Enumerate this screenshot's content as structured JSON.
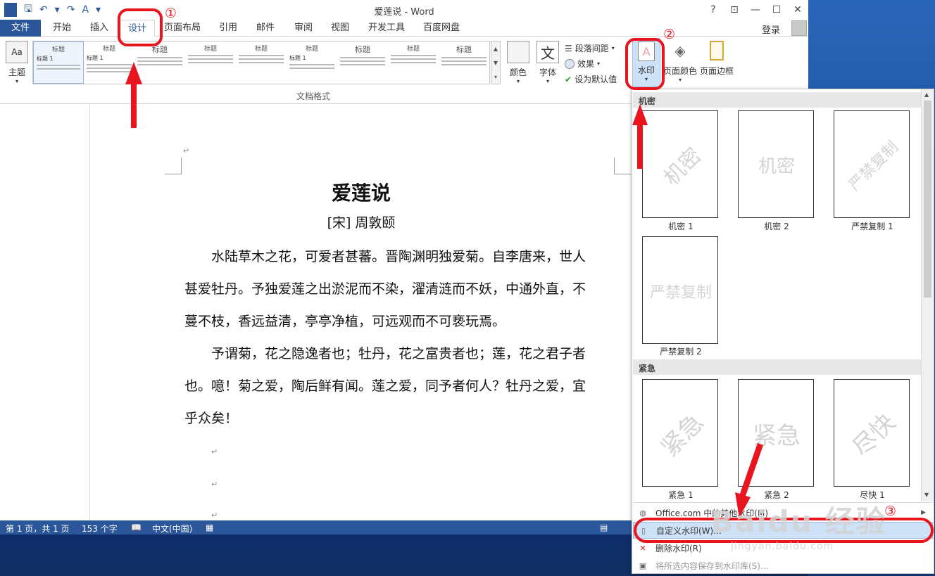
{
  "titlebar": {
    "title": "爱莲说 - Word",
    "help": "?",
    "restore_ribbon": "⊡",
    "minimize": "—",
    "maximize": "☐",
    "close": "✕",
    "qat_word": "W",
    "qat_save": "🖫",
    "qat_undo": "↶",
    "qat_redo": "↷",
    "qat_format": "A"
  },
  "tabs": [
    "文件",
    "开始",
    "插入",
    "设计",
    "页面布局",
    "引用",
    "邮件",
    "审阅",
    "视图",
    "开发工具",
    "百度网盘"
  ],
  "account": {
    "login": "登录"
  },
  "ribbon": {
    "theme": "主题",
    "gallery_title": "标题",
    "gallery_heading1": "标题 1",
    "colors": "颜色",
    "fonts": "字体",
    "font_glyph": "文",
    "paragraph_spacing": "段落间距",
    "effects": "效果",
    "set_default": "设为默认值",
    "watermark": "水印",
    "page_color": "页面颜色",
    "page_borders": "页面边框",
    "group_label": "文档格式"
  },
  "document": {
    "title": "爱莲说",
    "author": "[宋] 周敦颐",
    "lines": [
      "　　水陆草木之花，可爱者甚蕃。晋陶渊明独爱菊。自李唐来，世人",
      "甚爱牡丹。予独爱莲之出淤泥而不染，濯清涟而不妖，中通外直，不",
      "蔓不枝，香远益清，亭亭净植，可远观而不可亵玩焉。",
      "　　予谓菊，花之隐逸者也；牡丹，花之富贵者也；莲，花之君子者",
      "也。噫！菊之爱，陶后鲜有闻。莲之爱，同予者何人？牡丹之爱，宜",
      "乎众矣！"
    ],
    "para_mark": "↵"
  },
  "status": {
    "page": "第 1 页，共 1 页",
    "words": "153 个字",
    "lang": "中文(中国)"
  },
  "watermark_menu": {
    "section1": "机密",
    "section2": "紧急",
    "items": [
      {
        "label": "机密 1",
        "text": "机密"
      },
      {
        "label": "机密 2",
        "text": "机密"
      },
      {
        "label": "严禁复制 1",
        "text": "严禁复制"
      },
      {
        "label": "严禁复制 2",
        "text": "严禁复制"
      },
      {
        "label": "紧急 1",
        "text": "紧急"
      },
      {
        "label": "紧急 2",
        "text": "紧急"
      },
      {
        "label": "尽快 1",
        "text": "尽快"
      }
    ],
    "more": "Office.com 中的其他水印(M)",
    "custom": "自定义水印(W)...",
    "remove": "删除水印(R)",
    "save_selection": "将所选内容保存到水印库(S)..."
  },
  "annotations": {
    "n1": "①",
    "n2": "②",
    "n3": "③"
  },
  "site_watermark": {
    "big": "Baidu 经验",
    "small": "jingyan.baidu.com"
  }
}
